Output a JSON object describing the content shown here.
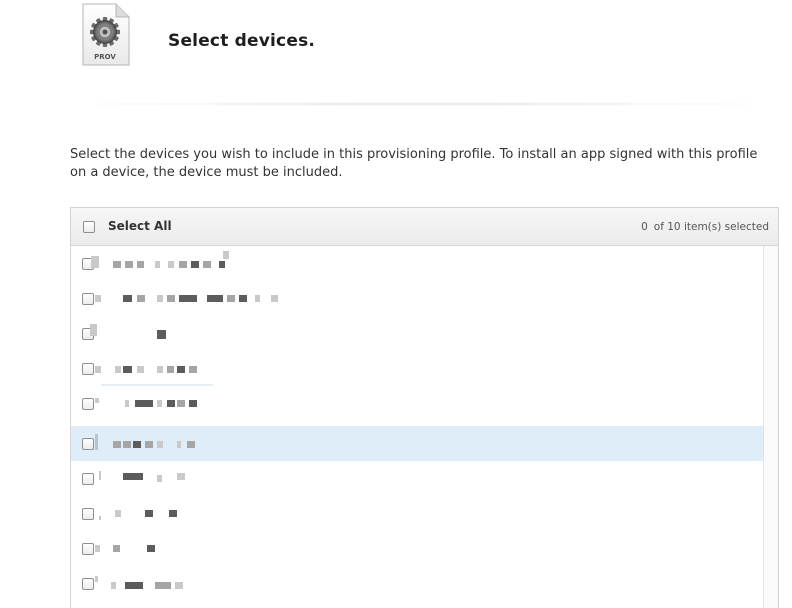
{
  "header": {
    "icon_label": "PROV",
    "icon_name": "provisioning-profile-gear-icon",
    "title": "Select devices."
  },
  "description": "Select the devices you wish to include in this provisioning profile. To install an app signed with this profile on a device, the device must be included.",
  "device_list": {
    "select_all_label": "Select All",
    "selected_count": "0",
    "count_suffix": "of 10 item(s) selected",
    "rows": [
      {
        "checked": false,
        "selected": false,
        "name_redacted": true
      },
      {
        "checked": false,
        "selected": false,
        "name_redacted": true
      },
      {
        "checked": false,
        "selected": false,
        "name_redacted": true
      },
      {
        "checked": false,
        "selected": false,
        "name_redacted": true
      },
      {
        "checked": false,
        "selected": false,
        "name_redacted": true
      },
      {
        "checked": false,
        "selected": true,
        "name_redacted": true
      },
      {
        "checked": false,
        "selected": false,
        "name_redacted": true
      },
      {
        "checked": false,
        "selected": false,
        "name_redacted": true
      },
      {
        "checked": false,
        "selected": false,
        "name_redacted": true
      },
      {
        "checked": false,
        "selected": false,
        "name_redacted": true
      }
    ]
  },
  "colors": {
    "row_highlight": "#deedf7",
    "header_bg": "#efefef",
    "title_text": "#1e1e1e",
    "body_text": "#333333"
  }
}
